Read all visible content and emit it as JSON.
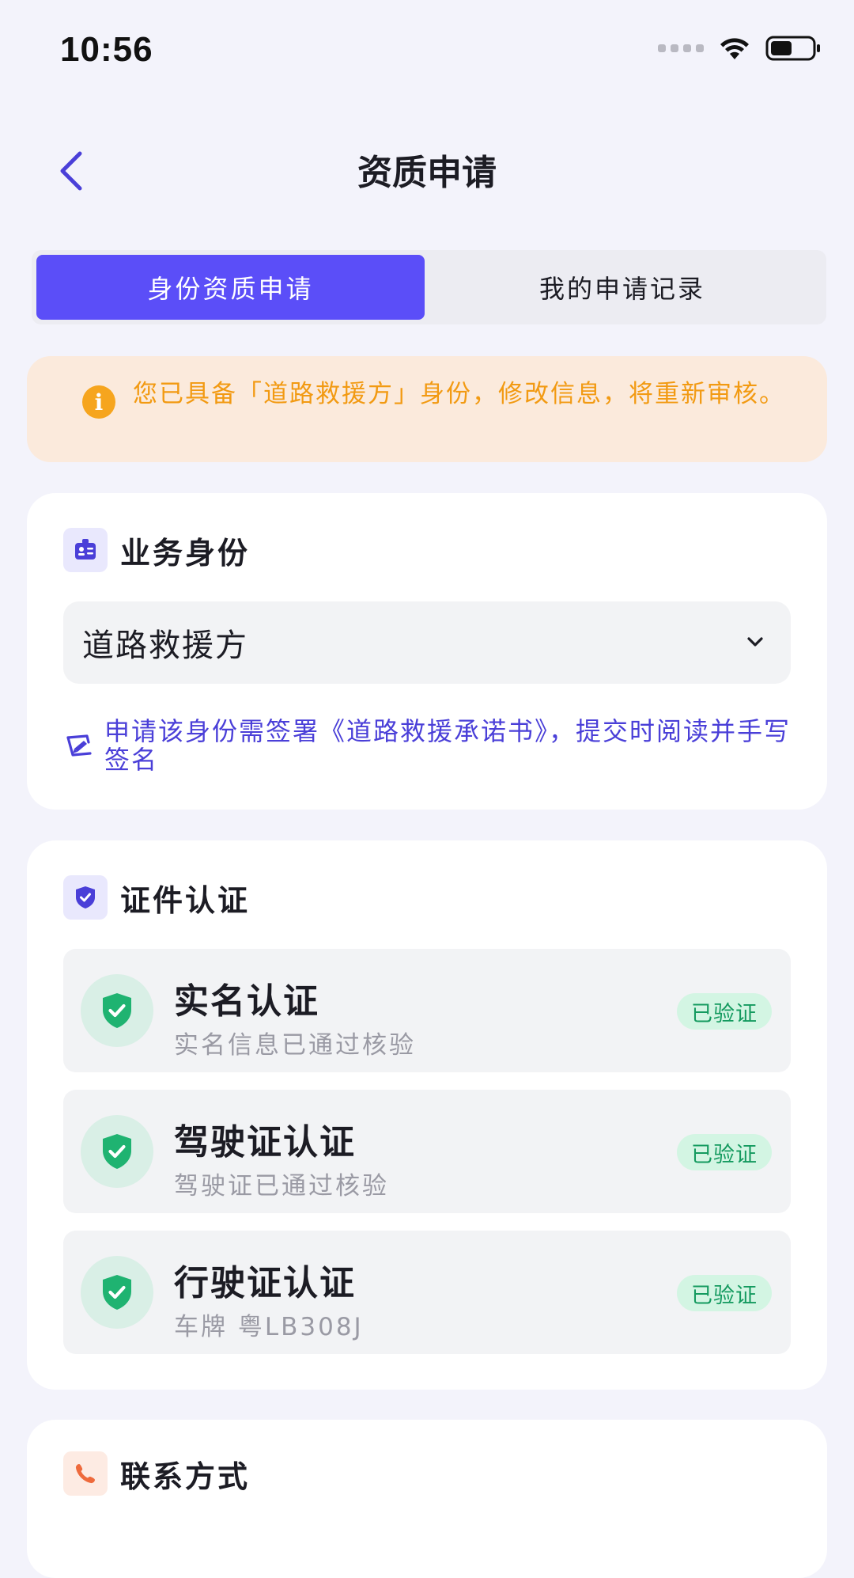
{
  "status_bar": {
    "time": "10:56"
  },
  "nav": {
    "title": "资质申请"
  },
  "tabs": [
    {
      "label": "身份资质申请",
      "active": true
    },
    {
      "label": "我的申请记录",
      "active": false
    }
  ],
  "notice": {
    "text": "您已具备「道路救援方」身份，修改信息，将重新审核。",
    "icon": "info-icon"
  },
  "identity": {
    "title": "业务身份",
    "selected_value": "道路救援方",
    "sign_note": "申请该身份需签署《道路救援承诺书》，提交时阅读并手写签名"
  },
  "certification": {
    "title": "证件认证",
    "items": [
      {
        "title": "实名认证",
        "subtitle": "实名信息已通过核验",
        "status": "已验证"
      },
      {
        "title": "驾驶证认证",
        "subtitle": "驾驶证已通过核验",
        "status": "已验证"
      },
      {
        "title": "行驶证认证",
        "subtitle": "车牌 粤LB308J",
        "status": "已验证"
      }
    ]
  },
  "contact": {
    "title": "联系方式"
  },
  "colors": {
    "accent": "#5b4ef8",
    "warning": "#f29a12",
    "success": "#149a5f",
    "background": "#f3f3fb"
  }
}
